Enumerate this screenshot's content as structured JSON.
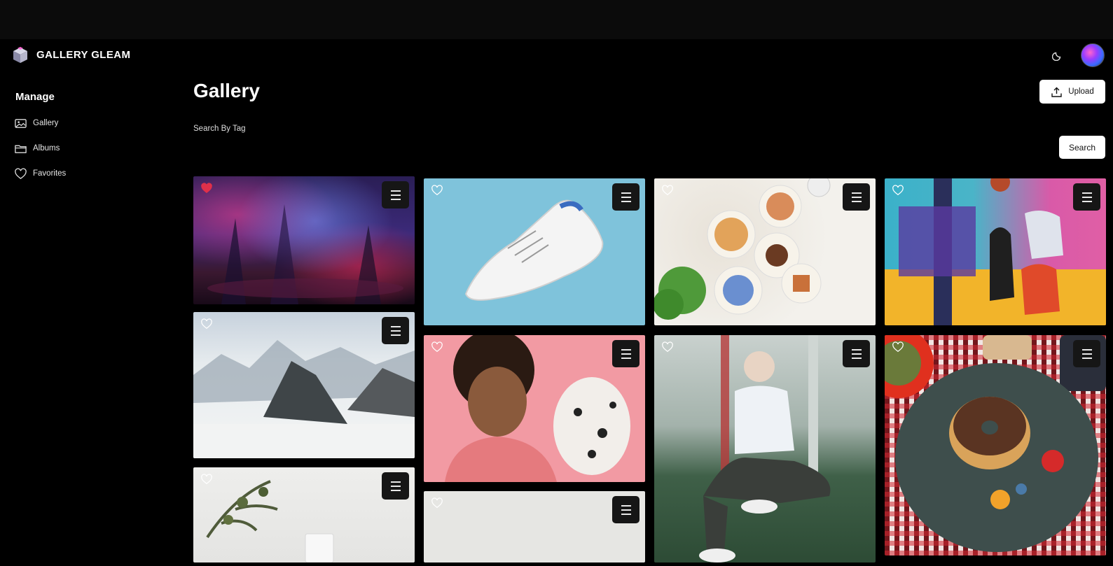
{
  "app": {
    "name": "GALLERY GLEAM"
  },
  "header": {
    "theme_icon": "moon-icon",
    "avatar_icon": "avatar"
  },
  "sidebar": {
    "title": "Manage",
    "items": [
      {
        "label": "Gallery",
        "icon": "image-icon"
      },
      {
        "label": "Albums",
        "icon": "folder-icon"
      },
      {
        "label": "Favorites",
        "icon": "heart-icon"
      }
    ]
  },
  "main": {
    "title": "Gallery",
    "upload_label": "Upload",
    "search_label": "Search By Tag",
    "search_value": "",
    "search_button": "Search"
  },
  "images": [
    {
      "subject": "forest",
      "favorited": true
    },
    {
      "subject": "shoe",
      "favorited": false
    },
    {
      "subject": "food",
      "favorited": false
    },
    {
      "subject": "basketball",
      "favorited": false
    },
    {
      "subject": "mountain",
      "favorited": false
    },
    {
      "subject": "woman-dog",
      "favorited": false
    },
    {
      "subject": "woman-court",
      "favorited": false
    },
    {
      "subject": "donut",
      "favorited": false
    },
    {
      "subject": "plant",
      "favorited": false
    },
    {
      "subject": "blank",
      "favorited": false
    }
  ],
  "colors": {
    "background": "#000000",
    "accent_fav": "#e0304a",
    "button_bg": "#ffffff"
  }
}
